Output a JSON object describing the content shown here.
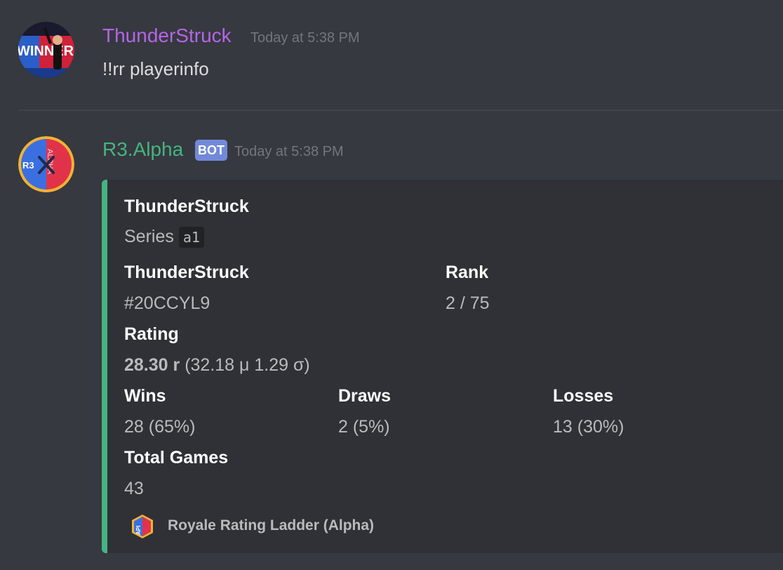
{
  "messages": [
    {
      "author": "ThunderStruck",
      "author_color": "#b565e8",
      "timestamp": "Today at 5:38 PM",
      "text": "!!rr playerinfo",
      "avatar_text": "WINNER"
    },
    {
      "author": "R3.Alpha",
      "author_color": "#43b581",
      "badge": "BOT",
      "timestamp": "Today at 5:38 PM",
      "avatar_left": "R3",
      "avatar_right": "ALPHA"
    }
  ],
  "embed": {
    "accent_color": "#43b581",
    "author_name": "ThunderStruck",
    "description_prefix": "Series",
    "series_code": "a1",
    "fields": {
      "player_name": "ThunderStruck",
      "player_tag": "#20CCYL9",
      "rank_label": "Rank",
      "rank_value": "2 / 75",
      "rating_label": "Rating",
      "rating_bold": "28.30 r",
      "rating_detail": "(32.18 μ 1.29 σ)",
      "wins_label": "Wins",
      "wins_value": "28 (65%)",
      "draws_label": "Draws",
      "draws_value": "2 (5%)",
      "losses_label": "Losses",
      "losses_value": "13 (30%)",
      "total_label": "Total Games",
      "total_value": "43"
    },
    "footer": {
      "icon_text": "API",
      "text": "Royale Rating Ladder (Alpha)"
    }
  }
}
